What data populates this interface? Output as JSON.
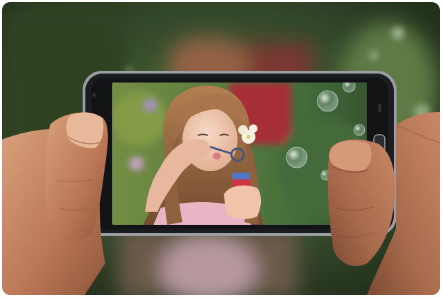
{
  "image": {
    "subject": "hands-holding-smartphone",
    "screen_content": "girl-blowing-bubbles",
    "palette": {
      "background_green": "#3f5a2c",
      "background_red": "#9b2f33",
      "phone_body": "#1c1c1e",
      "phone_trim": "#8f9296",
      "skin": "#c98a67",
      "hair": "#8a5a36",
      "dress_pink": "#e3a7b7"
    }
  }
}
